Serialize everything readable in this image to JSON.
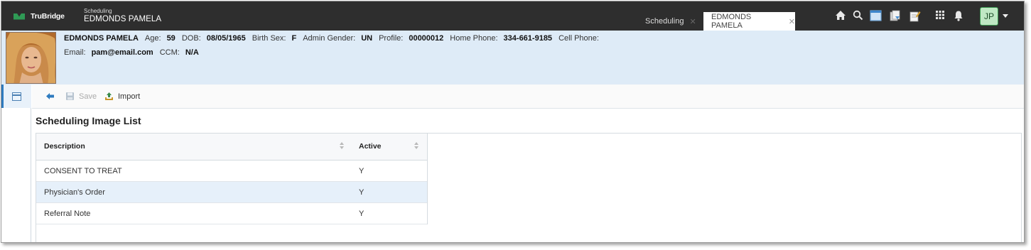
{
  "app": {
    "brand": "TruBridge",
    "module_label": "Scheduling",
    "patient_header": "EDMONDS PAMELA"
  },
  "tabs": [
    {
      "label": "Scheduling",
      "close": "✕"
    },
    {
      "label": "EDMONDS PAMELA",
      "close": "✕"
    }
  ],
  "top_icons": [
    "home-icon",
    "search-icon",
    "window-icon",
    "documents-icon",
    "notes-icon",
    "apps-grid-icon",
    "bell-icon"
  ],
  "user": {
    "initials": "JP"
  },
  "patient": {
    "name": "EDMONDS PAMELA",
    "age_label": "Age:",
    "age": "59",
    "dob_label": "DOB:",
    "dob": "08/05/1965",
    "birth_sex_label": "Birth Sex:",
    "birth_sex": "F",
    "admin_gender_label": "Admin Gender:",
    "admin_gender": "UN",
    "profile_label": "Profile:",
    "profile": "00000012",
    "home_phone_label": "Home Phone:",
    "home_phone": "334-661-9185",
    "cell_phone_label": "Cell Phone:",
    "cell_phone": "",
    "email_label": "Email:",
    "email": "pam@email.com",
    "ccm_label": "CCM:",
    "ccm": "N/A"
  },
  "toolbar": {
    "save_label": "Save",
    "import_label": "Import"
  },
  "page": {
    "title": "Scheduling Image List"
  },
  "table": {
    "columns": [
      "Description",
      "Active"
    ],
    "rows": [
      {
        "description": "CONSENT TO TREAT",
        "active": "Y"
      },
      {
        "description": "Physician's Order",
        "active": "Y"
      },
      {
        "description": "Referral Note",
        "active": "Y"
      }
    ],
    "selected_row": 1
  },
  "colors": {
    "topbar": "#2e2e2e",
    "banner": "#deebf7",
    "accent": "#2e7bbf",
    "brand_green": "#2f9a55"
  }
}
